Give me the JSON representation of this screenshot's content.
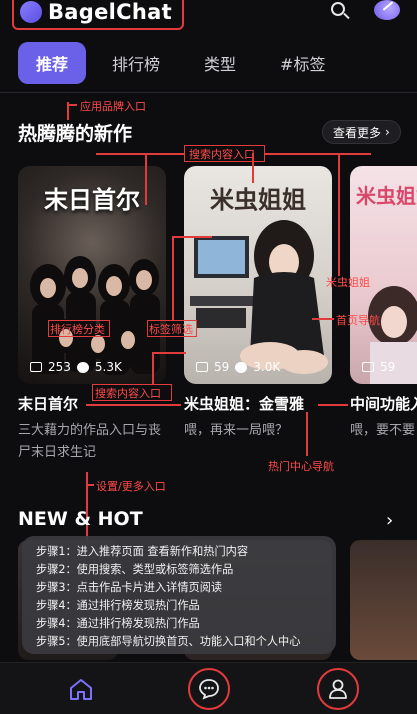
{
  "header": {
    "brand": "BagelChat"
  },
  "tabs": [
    "推荐",
    "排行榜",
    "类型",
    "#标签"
  ],
  "section1": {
    "title": "热腾腾的新作",
    "see_more": "查看更多"
  },
  "cards": [
    {
      "overlay": "末日首尔",
      "images": "253",
      "chats": "5.3K",
      "title": "末日首尔",
      "desc": "三大藉力的作品入口与丧尸末日求生记"
    },
    {
      "overlay": "米虫姐姐",
      "images": "59",
      "chats": "3.0K",
      "title": "米虫姐姐：金雪雅",
      "desc": "喂，再来一局喂？"
    },
    {
      "overlay": "米虫姐姐",
      "images": "59",
      "chats": "",
      "title": "中间功能入",
      "desc": "喂，要不要"
    }
  ],
  "section2": {
    "title": "NEW & HOT"
  },
  "steps": [
    "步骤1：进入推荐页面 查看新作和热门内容",
    "步骤2：使用搜索、类型或标签筛选作品",
    "步骤3：点击作品卡片进入详情页阅读",
    "步骤4：通过排行榜发现热门作品",
    "步骤4：通过排行榜发现热门作品",
    "步骤5：使用底部导航切换首页、功能入口和个人中心"
  ],
  "annotations": {
    "brand_entry": "应用品牌入口",
    "search_content_1": "搜索内容入口",
    "rank_category": "排行榜分类",
    "tag_filter": "标签筛选",
    "mico_sister": "米虫姐姐",
    "home_nav": "首页导航",
    "search_content_2": "搜索内容入口",
    "hot_center_nav": "热门中心导航",
    "settings_more": "设置/更多入口"
  },
  "colors": {
    "accent": "#6b60e8",
    "annotation": "#e23b3b",
    "background": "#0d0d0f"
  }
}
